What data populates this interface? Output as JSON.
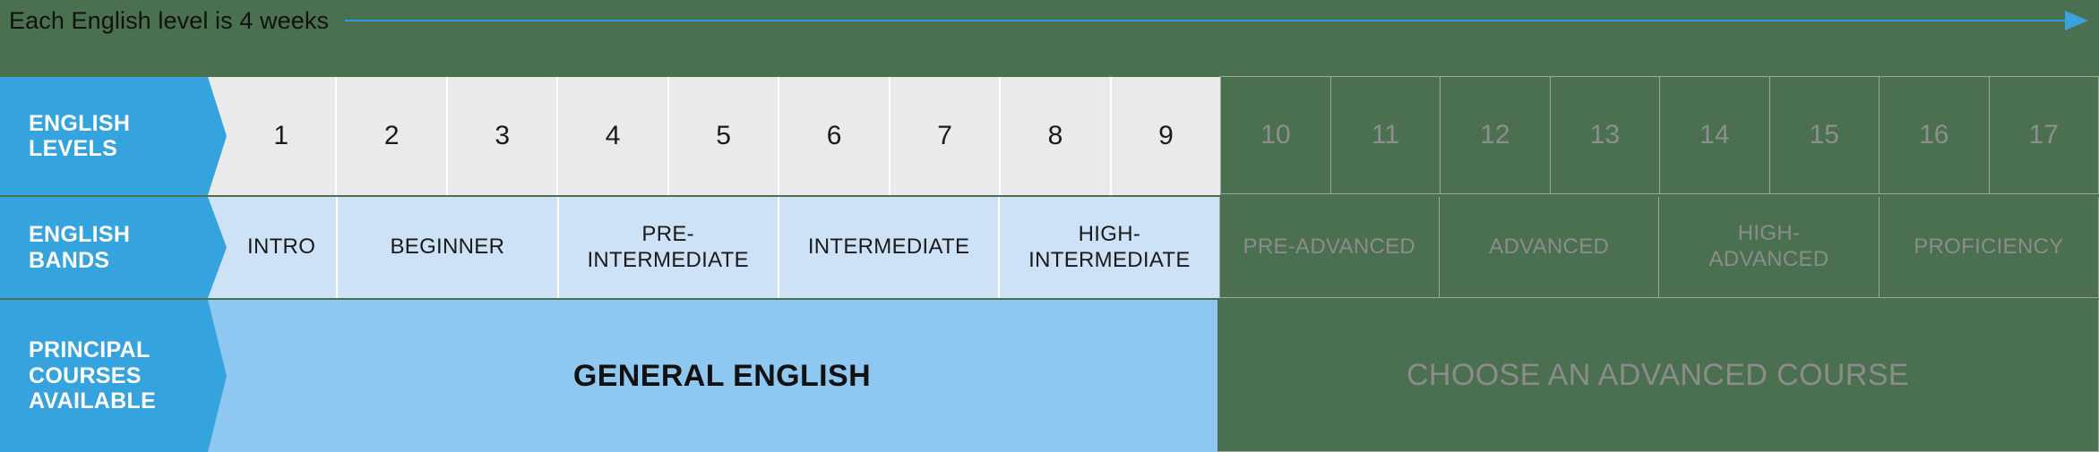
{
  "caption": {
    "text": "Each English level is 4 weeks",
    "arrow_icon": "arrow-right-icon",
    "arrow_color": "#2e9bd6"
  },
  "colors": {
    "background": "#4a7050",
    "header_blue": "#35a3de",
    "levels_cell": "#eaeaea",
    "bands_cell": "#cde2f7",
    "course_cell": "#8ec7ef",
    "muted_text": "#8c8c8c",
    "muted_border": "#9aa99c"
  },
  "rows": {
    "levels": {
      "header": "ENGLISH LEVELS",
      "active": [
        "1",
        "2",
        "3",
        "4",
        "5",
        "6",
        "7",
        "8",
        "9"
      ],
      "muted": [
        "10",
        "11",
        "12",
        "13",
        "14",
        "15",
        "16",
        "17"
      ]
    },
    "bands": {
      "header": "ENGLISH BANDS",
      "active": [
        {
          "label": "INTRO",
          "span": 1
        },
        {
          "label": "BEGINNER",
          "span": 2
        },
        {
          "label": "PRE-\nINTERMEDIATE",
          "span": 2
        },
        {
          "label": "INTERMEDIATE",
          "span": 2
        },
        {
          "label": "HIGH-\nINTERMEDIATE",
          "span": 2
        }
      ],
      "muted": [
        {
          "label": "PRE-ADVANCED",
          "span": 2
        },
        {
          "label": "ADVANCED",
          "span": 2
        },
        {
          "label": "HIGH-\nADVANCED",
          "span": 2
        },
        {
          "label": "PROFICIENCY",
          "span": 2
        }
      ]
    },
    "courses": {
      "header": "PRINCIPAL COURSES AVAILABLE",
      "active": {
        "label": "GENERAL ENGLISH",
        "span": 9
      },
      "muted": {
        "label": "CHOOSE AN ADVANCED COURSE",
        "span": 8
      }
    }
  }
}
